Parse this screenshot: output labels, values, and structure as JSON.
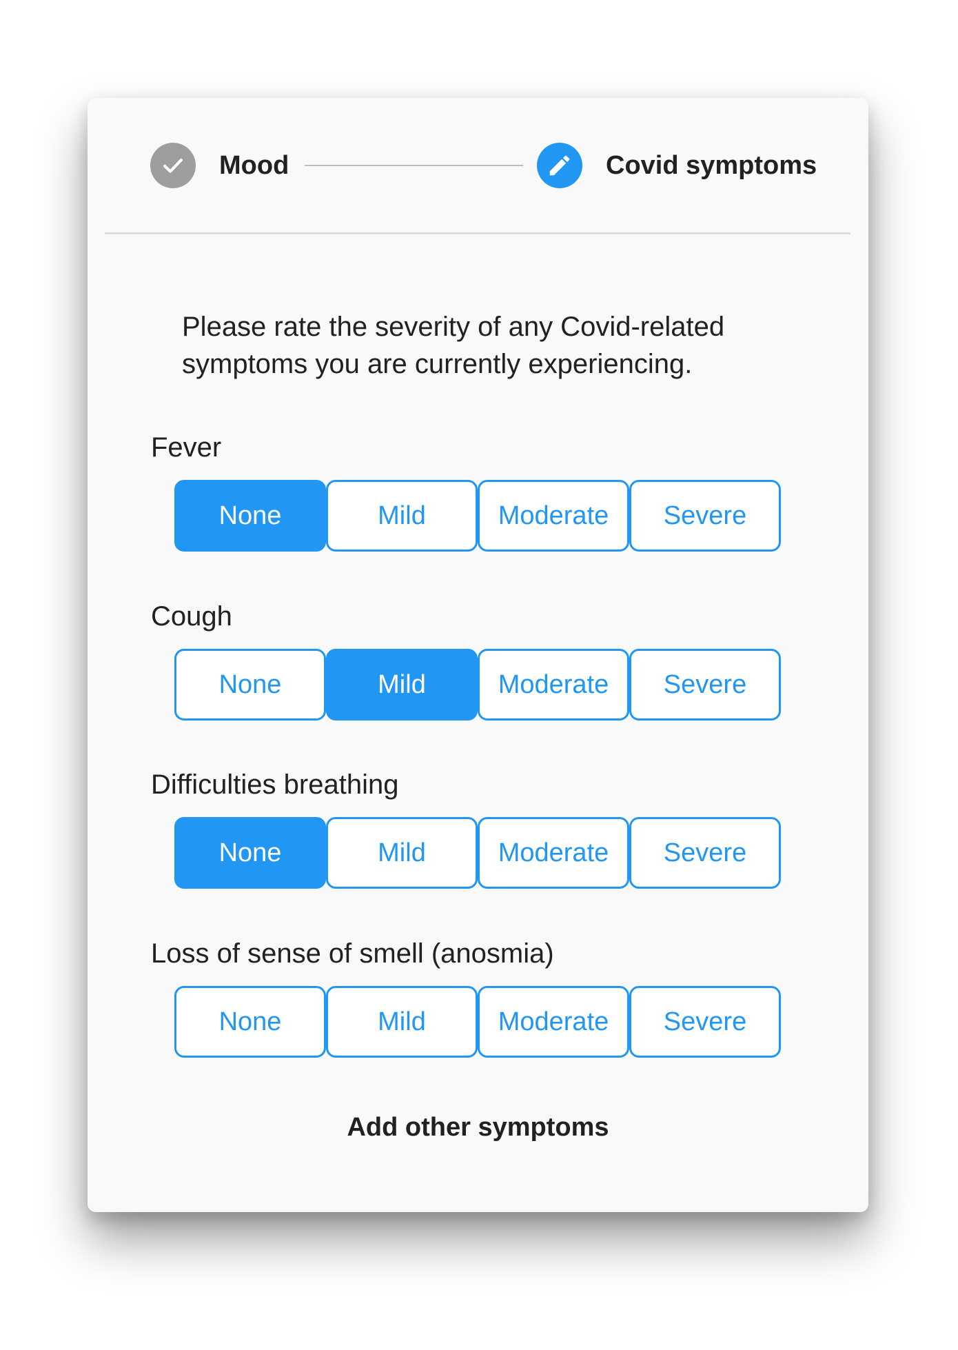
{
  "stepper": {
    "steps": [
      {
        "label": "Mood",
        "state": "completed",
        "icon": "check-icon"
      },
      {
        "label": "Covid symptoms",
        "state": "active",
        "icon": "pencil-icon"
      }
    ]
  },
  "instructions": "Please rate the severity of any Covid-related symptoms you are currently experiencing.",
  "severity_options": [
    "None",
    "Mild",
    "Moderate",
    "Severe"
  ],
  "symptoms": [
    {
      "label": "Fever",
      "selected": "None"
    },
    {
      "label": "Cough",
      "selected": "Mild"
    },
    {
      "label": "Difficulties breathing",
      "selected": "None"
    },
    {
      "label": "Loss of sense of smell (anosmia)",
      "selected": ""
    }
  ],
  "add_other_symptoms": "Add other symptoms",
  "colors": {
    "accent": "#2196f3",
    "completed_step": "#9e9e9e",
    "text": "#212121",
    "card_background": "#f9f9f9"
  }
}
